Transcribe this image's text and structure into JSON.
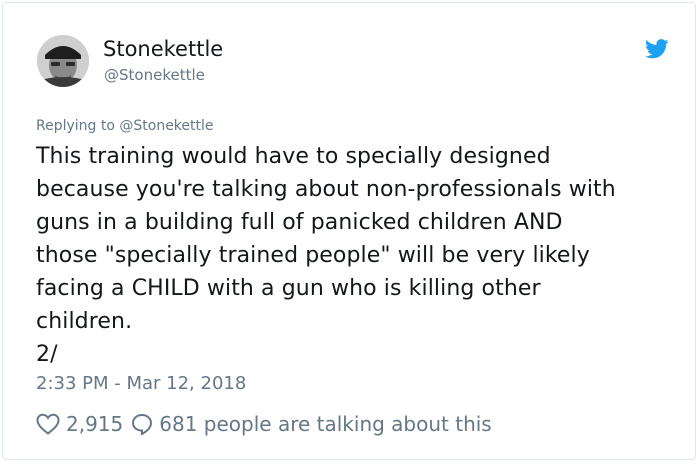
{
  "user": {
    "display_name": "Stonekettle",
    "screen_name": "@Stonekettle"
  },
  "replying_to": "Replying to @Stonekettle",
  "tweet": {
    "lines": [
      "This training would have to specially designed",
      "because you're talking about non-professionals with",
      "guns in a building full of panicked children AND",
      "those \"specially trained people\" will be very likely",
      "facing a CHILD with a gun who is killing other",
      "children.",
      "2/"
    ]
  },
  "timestamp": "2:33 PM - Mar 12, 2018",
  "actions": {
    "likes": "2,915",
    "talking": "681 people are talking about this"
  },
  "icons": {
    "platform": "twitter-bird-icon",
    "like": "heart-icon",
    "reply": "speech-bubble-icon"
  },
  "colors": {
    "brand": "#1da1f2",
    "secondary_text": "#657786",
    "primary_text": "#14171a"
  }
}
